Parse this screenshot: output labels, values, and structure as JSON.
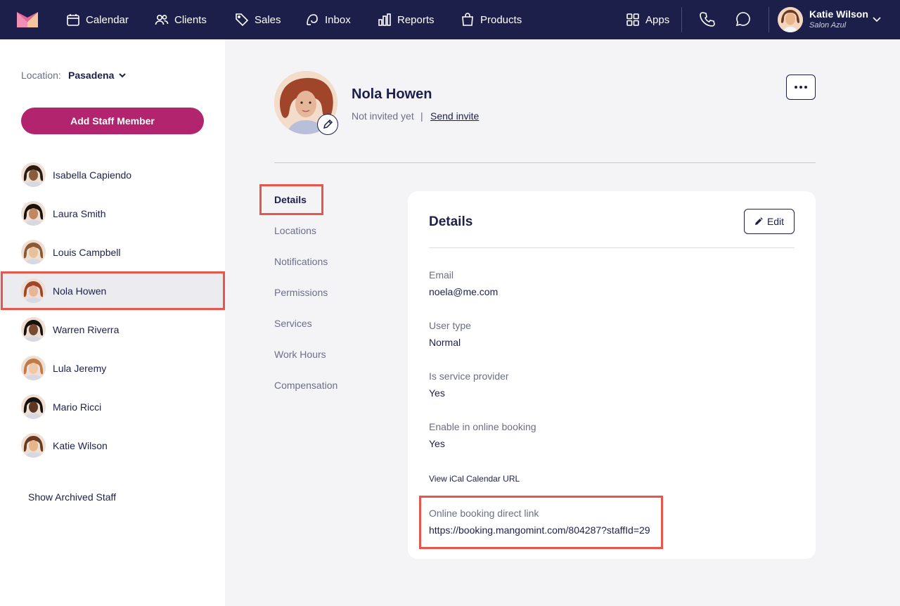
{
  "nav": {
    "items": [
      {
        "label": "Calendar",
        "icon": "calendar-icon"
      },
      {
        "label": "Clients",
        "icon": "users-icon"
      },
      {
        "label": "Sales",
        "icon": "tag-icon"
      },
      {
        "label": "Inbox",
        "icon": "inbox-icon"
      },
      {
        "label": "Reports",
        "icon": "bar-chart-icon"
      },
      {
        "label": "Products",
        "icon": "bag-icon"
      }
    ],
    "apps_label": "Apps",
    "user": {
      "name": "Katie Wilson",
      "salon": "Salon Azul"
    }
  },
  "sidebar": {
    "location_label": "Location:",
    "location_value": "Pasadena",
    "add_staff_label": "Add Staff Member",
    "staff": [
      {
        "name": "Isabella Capiendo",
        "skin": "#8a5a3c",
        "hair": "#2a1a10"
      },
      {
        "name": "Laura Smith",
        "skin": "#c08860",
        "hair": "#1a110b"
      },
      {
        "name": "Louis Campbell",
        "skin": "#e8c09c",
        "hair": "#8a5a34"
      },
      {
        "name": "Nola Howen",
        "skin": "#e6b69a",
        "hair": "#a0452a"
      },
      {
        "name": "Warren Riverra",
        "skin": "#7a4a30",
        "hair": "#1a110b"
      },
      {
        "name": "Lula Jeremy",
        "skin": "#f0c8a8",
        "hair": "#c07a48"
      },
      {
        "name": "Mario Ricci",
        "skin": "#5a3826",
        "hair": "#1a110b"
      },
      {
        "name": "Katie Wilson",
        "skin": "#e8b48a",
        "hair": "#6a3a1e"
      }
    ],
    "show_archived_label": "Show Archived Staff"
  },
  "profile": {
    "name": "Nola Howen",
    "invite_status": "Not invited yet",
    "separator": "|",
    "send_invite_label": "Send invite"
  },
  "tabs": [
    "Details",
    "Locations",
    "Notifications",
    "Permissions",
    "Services",
    "Work Hours",
    "Compensation"
  ],
  "details": {
    "title": "Details",
    "edit_label": "Edit",
    "fields": [
      {
        "label": "Email",
        "value": "noela@me.com"
      },
      {
        "label": "User type",
        "value": "Normal"
      },
      {
        "label": "Is service provider",
        "value": "Yes"
      },
      {
        "label": "Enable in online booking",
        "value": "Yes"
      }
    ],
    "ical_label": "View iCal Calendar URL",
    "booking_label": "Online booking direct link",
    "booking_url": "https://booking.mangomint.com/804287?staffId=29"
  },
  "colors": {
    "nav_bg": "#1c1f4a",
    "accent": "#b3246e",
    "highlight": "#e8554a",
    "text": "#1c1f4a",
    "muted": "#6b6e86"
  }
}
